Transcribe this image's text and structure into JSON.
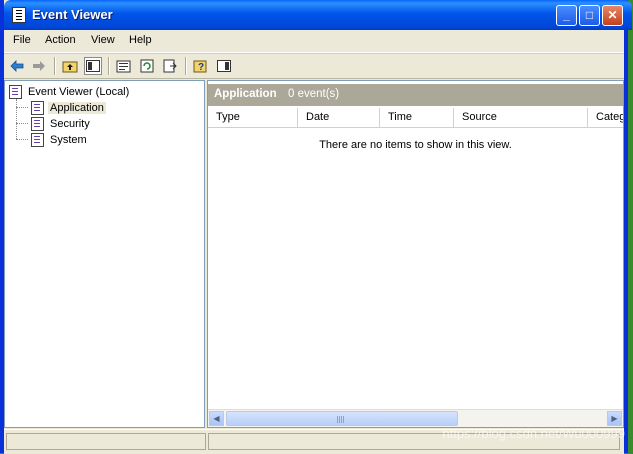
{
  "window": {
    "title": "Event Viewer",
    "controls": {
      "minimize": "_",
      "maximize": "□",
      "close": "✕"
    }
  },
  "menu": {
    "items": [
      "File",
      "Action",
      "View",
      "Help"
    ]
  },
  "toolbar": {
    "buttons": [
      "back-icon",
      "forward-icon",
      "up-folder-icon",
      "show-hide-tree-icon",
      "properties-icon",
      "refresh-icon",
      "export-list-icon",
      "help-icon",
      "show-hide-action-pane-icon"
    ]
  },
  "tree": {
    "root": "Event Viewer (Local)",
    "nodes": [
      "Application",
      "Security",
      "System"
    ],
    "selected": "Application"
  },
  "details": {
    "title": "Application",
    "count": "0 event(s)",
    "columns": [
      "Type",
      "Date",
      "Time",
      "Source",
      "Categ"
    ],
    "empty_message": "There are no items to show in this view."
  },
  "watermark": "https://blog.csdn.net/Wu000999"
}
